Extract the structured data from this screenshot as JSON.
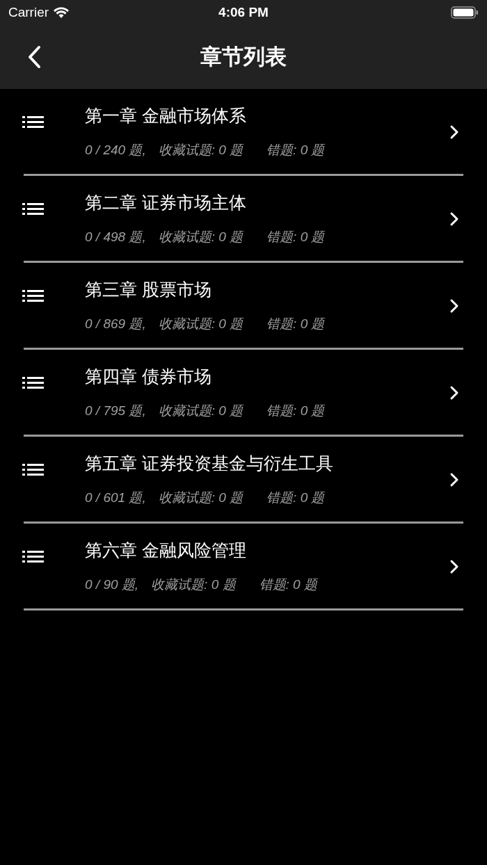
{
  "status_bar": {
    "carrier": "Carrier",
    "time": "4:06 PM"
  },
  "nav": {
    "title": "章节列表"
  },
  "chapters": [
    {
      "title": "第一章 金融市场体系",
      "progress": "0 / 240 题,",
      "favorites": "收藏试题: 0 题",
      "wrong": "错题: 0 题"
    },
    {
      "title": "第二章 证券市场主体",
      "progress": "0 / 498 题,",
      "favorites": "收藏试题: 0 题",
      "wrong": "错题: 0 题"
    },
    {
      "title": "第三章 股票市场",
      "progress": "0 / 869 题,",
      "favorites": "收藏试题: 0 题",
      "wrong": "错题: 0 题"
    },
    {
      "title": "第四章 债券市场",
      "progress": "0 / 795 题,",
      "favorites": "收藏试题: 0 题",
      "wrong": "错题: 0 题"
    },
    {
      "title": "第五章 证券投资基金与衍生工具",
      "progress": "0 / 601 题,",
      "favorites": "收藏试题: 0 题",
      "wrong": "错题: 0 题"
    },
    {
      "title": "第六章 金融风险管理",
      "progress": "0 / 90 题,",
      "favorites": "收藏试题: 0 题",
      "wrong": "错题: 0 题"
    }
  ]
}
